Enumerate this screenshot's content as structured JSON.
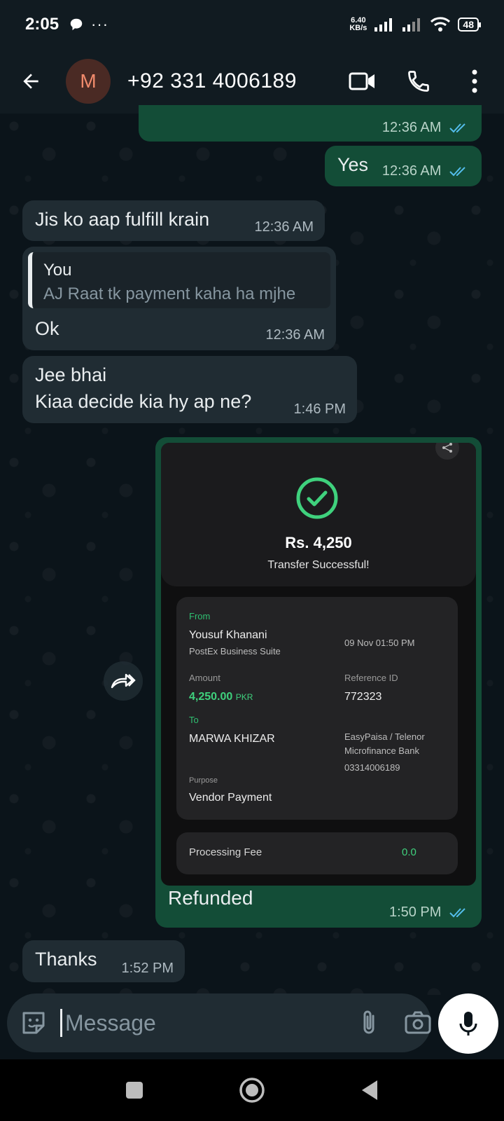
{
  "status_bar": {
    "time": "2:05",
    "net_speed_value": "6.40",
    "net_speed_unit": "KB/s",
    "battery": "48"
  },
  "header": {
    "avatar_letter": "M",
    "contact_name": "+92 331 4006189"
  },
  "messages": [
    {
      "id": "m0",
      "direction": "out",
      "text": "",
      "time": "12:36 AM",
      "read": true
    },
    {
      "id": "m1",
      "direction": "out",
      "text": "Yes",
      "time": "12:36 AM",
      "read": true
    },
    {
      "id": "m2",
      "direction": "in",
      "text": "Jis ko aap fulfill krain",
      "time": "12:36 AM"
    },
    {
      "id": "m3",
      "direction": "in",
      "quote_author": "You",
      "quote_text": "AJ Raat tk payment kaha ha mjhe",
      "text": "Ok",
      "time": "12:36 AM"
    },
    {
      "id": "m4",
      "direction": "in",
      "line1": "Jee bhai",
      "line2": "Kiaa decide kia hy ap ne?",
      "time": "1:46 PM"
    },
    {
      "id": "m5",
      "direction": "out",
      "caption": "Refunded",
      "time": "1:50 PM",
      "read": true
    },
    {
      "id": "m6",
      "direction": "in",
      "text": "Thanks",
      "time": "1:52 PM"
    }
  ],
  "receipt": {
    "amount": "Rs. 4,250",
    "status": "Transfer Successful!",
    "from_label": "From",
    "from_name": "Yousuf Khanani",
    "from_sub": "PostEx Business Suite",
    "datetime": "09 Nov 01:50 PM",
    "amount_label": "Amount",
    "amount_value": "4,250.00",
    "amount_unit": "PKR",
    "reference_label": "Reference ID",
    "reference_value": "772323",
    "to_label": "To",
    "to_name": "MARWA KHIZAR",
    "to_bank_line1": "EasyPaisa / Telenor",
    "to_bank_line2": "Microfinance Bank",
    "to_account": "03314006189",
    "purpose_label": "Purpose",
    "purpose_value": "Vendor Payment",
    "fee_label": "Processing Fee",
    "fee_value": "0.0"
  },
  "composer": {
    "placeholder": "Message"
  },
  "colors": {
    "background": "#0b141a",
    "incoming_bubble": "#202c33",
    "outgoing_bubble": "#134d37",
    "read_tick": "#53bdeb",
    "success_green": "#3fd17d"
  }
}
